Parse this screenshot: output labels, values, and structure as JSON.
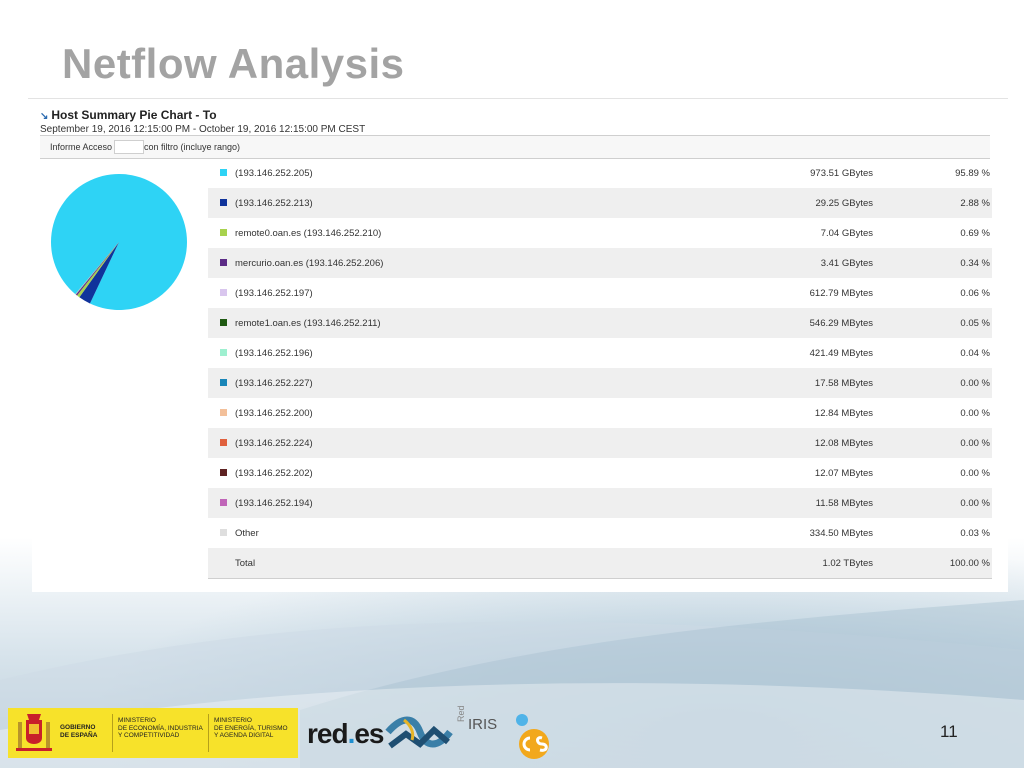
{
  "slide": {
    "title": "Netflow Analysis",
    "page_number": "11"
  },
  "panel": {
    "title": "Host Summary Pie Chart - To",
    "subtitle": "September 19, 2016 12:15:00 PM - October 19, 2016 12:15:00 PM CEST",
    "filter_prefix": "Informe Acceso",
    "filter_suffix": "con filtro (incluye rango)"
  },
  "chart_data": {
    "type": "pie",
    "title": "Host Summary Pie Chart - To",
    "series": [
      {
        "label": "(193.146.252.205)",
        "amount": "973.51 GBytes",
        "percent": 95.89,
        "percent_label": "95.89 %",
        "color": "#2ed3f5"
      },
      {
        "label": "(193.146.252.213)",
        "amount": "29.25 GBytes",
        "percent": 2.88,
        "percent_label": "2.88 %",
        "color": "#10339b"
      },
      {
        "label": "remote0.oan.es (193.146.252.210)",
        "amount": "7.04 GBytes",
        "percent": 0.69,
        "percent_label": "0.69 %",
        "color": "#a8d24e"
      },
      {
        "label": "mercurio.oan.es (193.146.252.206)",
        "amount": "3.41 GBytes",
        "percent": 0.34,
        "percent_label": "0.34 %",
        "color": "#5c2c86"
      },
      {
        "label": "(193.146.252.197)",
        "amount": "612.79 MBytes",
        "percent": 0.06,
        "percent_label": "0.06 %",
        "color": "#d9c6ee"
      },
      {
        "label": "remote1.oan.es (193.146.252.211)",
        "amount": "546.29 MBytes",
        "percent": 0.05,
        "percent_label": "0.05 %",
        "color": "#1f5a12"
      },
      {
        "label": "(193.146.252.196)",
        "amount": "421.49 MBytes",
        "percent": 0.04,
        "percent_label": "0.04 %",
        "color": "#9ef0d0"
      },
      {
        "label": "(193.146.252.227)",
        "amount": "17.58 MBytes",
        "percent": 0.0,
        "percent_label": "0.00 %",
        "color": "#1a86b8"
      },
      {
        "label": "(193.146.252.200)",
        "amount": "12.84 MBytes",
        "percent": 0.0,
        "percent_label": "0.00 %",
        "color": "#f3c09a"
      },
      {
        "label": "(193.146.252.224)",
        "amount": "12.08 MBytes",
        "percent": 0.0,
        "percent_label": "0.00 %",
        "color": "#e0603d"
      },
      {
        "label": "(193.146.252.202)",
        "amount": "12.07 MBytes",
        "percent": 0.0,
        "percent_label": "0.00 %",
        "color": "#5e2222"
      },
      {
        "label": "(193.146.252.194)",
        "amount": "11.58 MBytes",
        "percent": 0.0,
        "percent_label": "0.00 %",
        "color": "#c065b8"
      },
      {
        "label": "Other",
        "amount": "334.50 MBytes",
        "percent": 0.03,
        "percent_label": "0.03 %",
        "color": "#dedede"
      }
    ],
    "total": {
      "label": "Total",
      "amount": "1.02 TBytes",
      "percent_label": "100.00 %"
    }
  },
  "footer": {
    "gov_line1": "GOBIERNO",
    "gov_line2": "DE ESPAÑA",
    "ministry1_line1": "MINISTERIO",
    "ministry1_line2": "DE ECONOMÍA, INDUSTRIA",
    "ministry1_line3": "Y COMPETITIVIDAD",
    "ministry2_line1": "MINISTERIO",
    "ministry2_line2": "DE ENERGÍA, TURISMO",
    "ministry2_line3": "Y AGENDA DIGITAL",
    "redes_text_a": "red",
    "redes_text_dot": ".",
    "redes_text_b": "es",
    "rediris_small": "Red",
    "rediris_big": "IRIS"
  }
}
